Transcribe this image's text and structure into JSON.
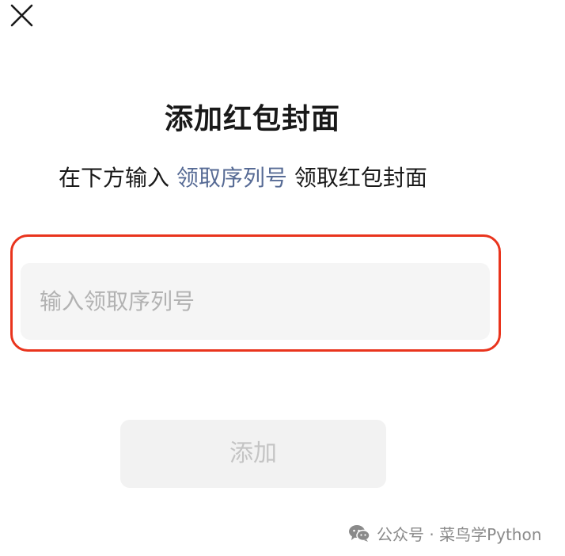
{
  "header": {
    "close_icon": "close-icon"
  },
  "page": {
    "title": "添加红包封面",
    "subtitle_prefix": "在下方输入",
    "subtitle_link": "领取序列号",
    "subtitle_suffix": "领取红包封面"
  },
  "form": {
    "serial_input": {
      "placeholder": "输入领取序列号",
      "value": ""
    },
    "add_button_label": "添加"
  },
  "watermark": {
    "icon": "wechat-icon",
    "text": "公众号 · 菜鸟学Python"
  },
  "colors": {
    "link": "#576b95",
    "highlight_border": "#e9341d",
    "input_bg": "#f5f5f5",
    "button_disabled_bg": "#f2f2f2",
    "button_disabled_text": "#c4c4c4"
  }
}
